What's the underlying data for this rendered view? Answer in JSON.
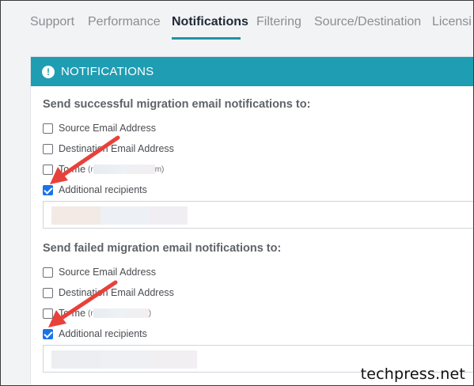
{
  "tabs": [
    {
      "label": "Support"
    },
    {
      "label": "Performance"
    },
    {
      "label": "Notifications"
    },
    {
      "label": "Filtering"
    },
    {
      "label": "Source/Destination"
    },
    {
      "label": "Licensi"
    }
  ],
  "active_tab": "Notifications",
  "panel": {
    "title": "NOTIFICATIONS",
    "success": {
      "heading": "Send successful migration email notifications to:",
      "options": [
        {
          "label": "Source Email Address",
          "checked": false
        },
        {
          "label": "Destination Email Address",
          "checked": false
        },
        {
          "label": "To me",
          "suffix": "(r",
          "suffix_end": "m)",
          "checked": false
        },
        {
          "label": "Additional recipients",
          "checked": true
        }
      ]
    },
    "failure": {
      "heading": "Send failed migration email notifications to:",
      "options": [
        {
          "label": "Source Email Address",
          "checked": false
        },
        {
          "label": "Destination Email Address",
          "checked": false
        },
        {
          "label": "To me",
          "suffix": "(r",
          "suffix_end": ")",
          "checked": false
        },
        {
          "label": "Additional recipients",
          "checked": true
        }
      ]
    }
  },
  "annotation_color": "#e8413a",
  "accent": "#1f9db3",
  "watermark": "techpress.net"
}
